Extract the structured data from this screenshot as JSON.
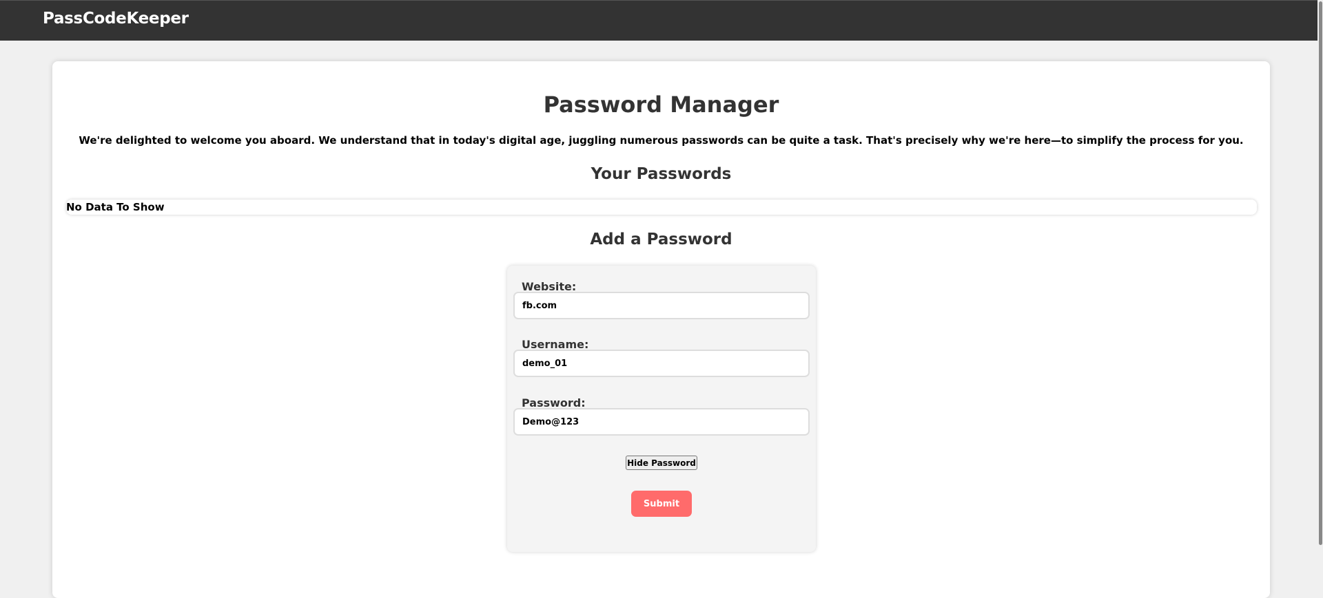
{
  "navbar": {
    "brand": "PassCodeKeeper"
  },
  "main": {
    "title": "Password Manager",
    "welcome": "We're delighted to welcome you aboard. We understand that in today's digital age, juggling numerous passwords can be quite a task. That's precisely why we're here—to simplify the process for you.",
    "passwords_heading": "Your Passwords",
    "empty_message": "No Data To Show",
    "add_heading": "Add a Password"
  },
  "form": {
    "website_label": "Website:",
    "website_value": "fb.com",
    "username_label": "Username:",
    "username_value": "demo_01",
    "password_label": "Password:",
    "password_value": "Demo@123",
    "toggle_label": "Hide Password",
    "submit_label": "Submit"
  },
  "colors": {
    "navbar": "#333333",
    "submit": "#ff6b6b"
  }
}
